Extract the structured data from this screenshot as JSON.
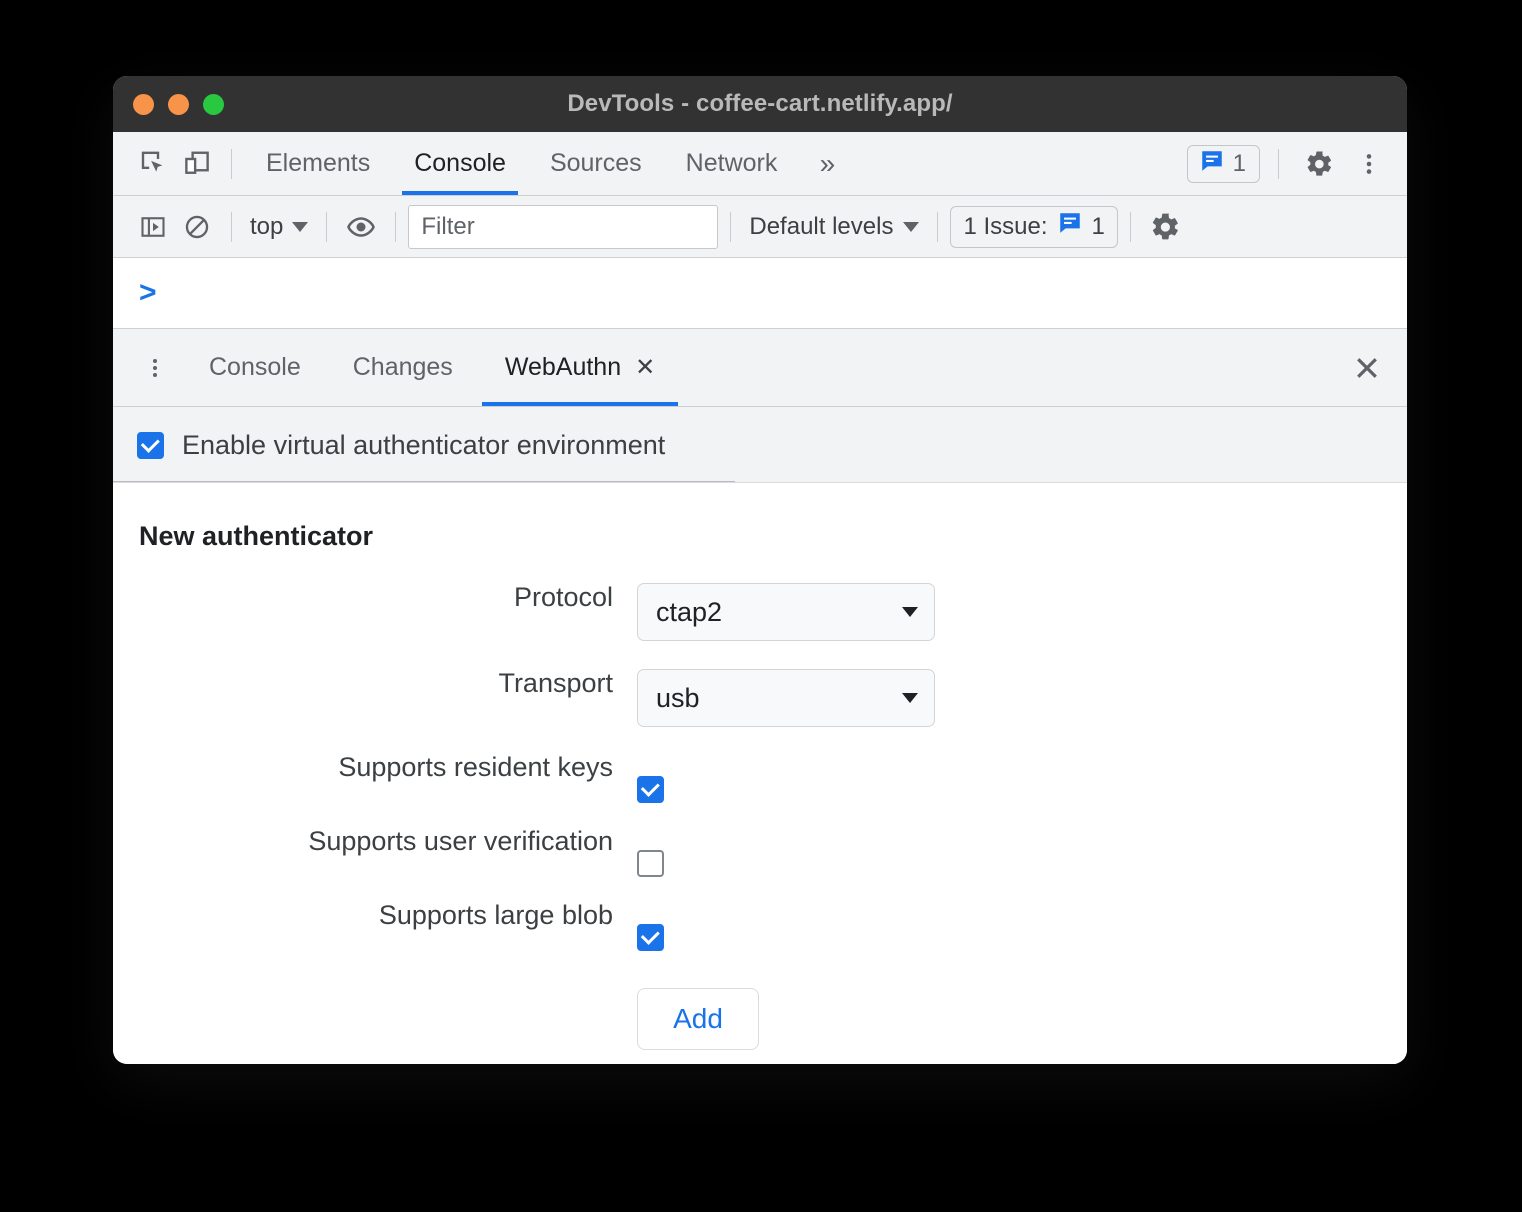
{
  "window": {
    "title": "DevTools - coffee-cart.netlify.app/",
    "traffic_lights": [
      "close",
      "minimize",
      "zoom"
    ],
    "accent_blue": "#1a73e8",
    "titlebar_bg": "#323232",
    "toolbar_bg": "#f1f3f4"
  },
  "panel_toolbar": {
    "inspect_icon": "inspect-element-icon",
    "device_icon": "device-toolbar-icon",
    "tabs": [
      {
        "label": "Elements",
        "active": false
      },
      {
        "label": "Console",
        "active": true
      },
      {
        "label": "Sources",
        "active": false
      },
      {
        "label": "Network",
        "active": false
      }
    ],
    "more_tabs_glyph": "»",
    "issues_count": "1",
    "issues_icon": "issues-message-icon",
    "settings_icon": "gear-icon",
    "kebab_icon": "more-options-icon"
  },
  "console_toolbar": {
    "sidebar_toggle_icon": "console-sidebar-icon",
    "clear_icon": "clear-console-icon",
    "context_value": "top",
    "live_expression_icon": "eye-icon",
    "filter_placeholder": "Filter",
    "filter_value": "",
    "levels_value": "Default levels",
    "issues_label": "1 Issue:",
    "issues_badge_count": "1",
    "settings_icon": "gear-icon"
  },
  "console_output": {
    "prompt": ">"
  },
  "drawer": {
    "kebab_icon": "drawer-more-options-icon",
    "tabs": [
      {
        "label": "Console",
        "active": false,
        "closable": false
      },
      {
        "label": "Changes",
        "active": false,
        "closable": false
      },
      {
        "label": "WebAuthn",
        "active": true,
        "closable": true,
        "close_glyph": "✕"
      }
    ],
    "close_drawer_glyph": "✕"
  },
  "webauthn": {
    "enable_checkbox": {
      "label": "Enable virtual authenticator environment",
      "checked": true
    },
    "section_title": "New authenticator",
    "fields": [
      {
        "label": "Protocol",
        "type": "select",
        "value": "ctap2"
      },
      {
        "label": "Transport",
        "type": "select",
        "value": "usb"
      },
      {
        "label": "Supports resident keys",
        "type": "checkbox",
        "checked": true
      },
      {
        "label": "Supports user verification",
        "type": "checkbox",
        "checked": false
      },
      {
        "label": "Supports large blob",
        "type": "checkbox",
        "checked": true
      }
    ],
    "add_button": "Add"
  }
}
